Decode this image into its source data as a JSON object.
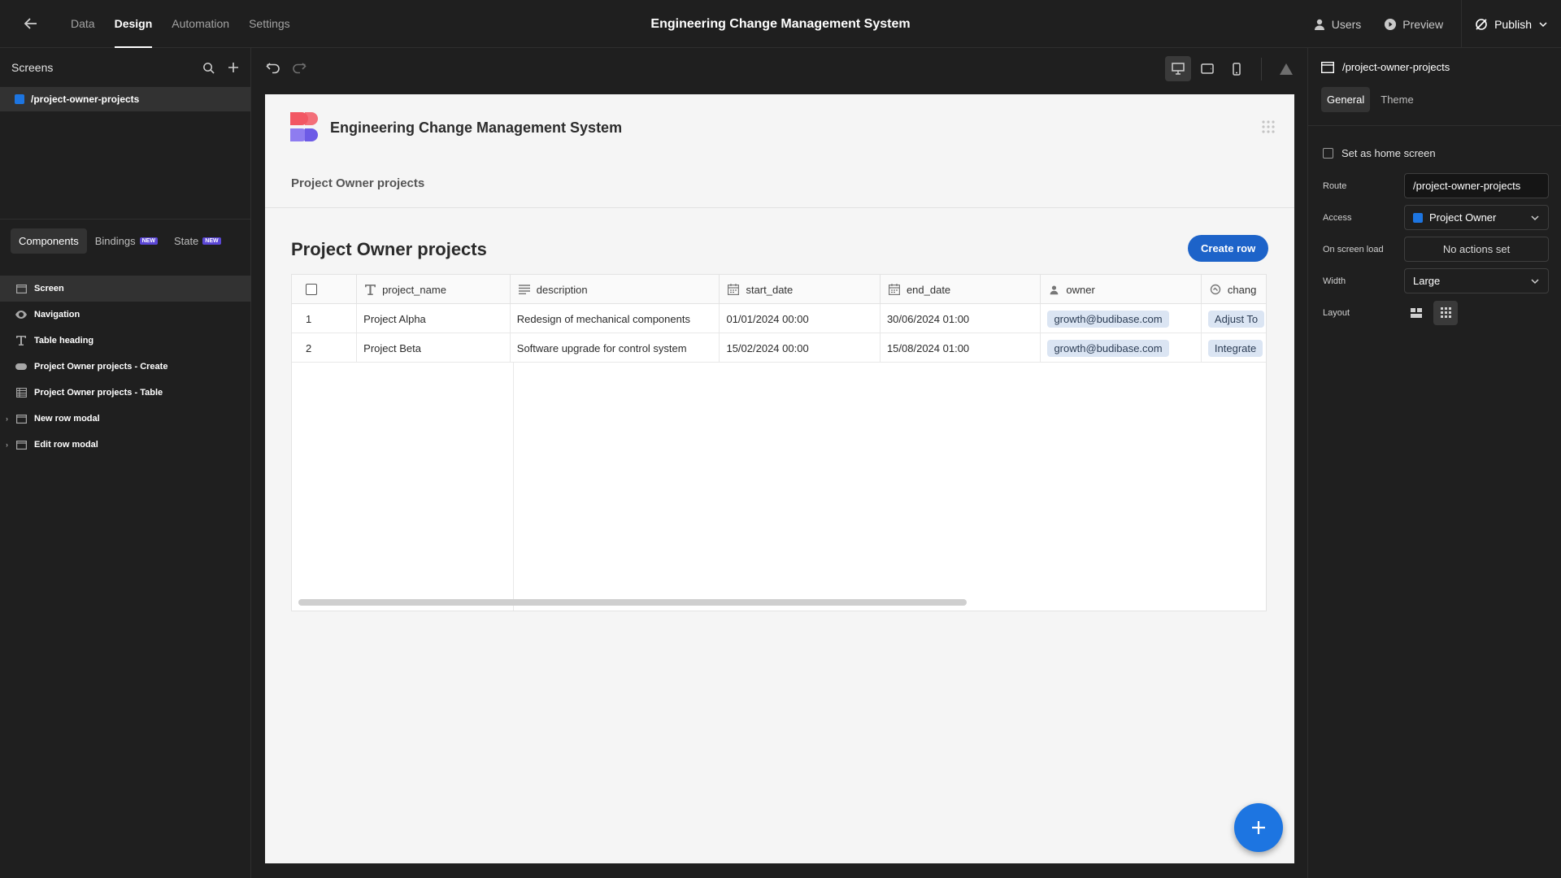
{
  "topbar": {
    "nav": [
      "Data",
      "Design",
      "Automation",
      "Settings"
    ],
    "active_nav": "Design",
    "title": "Engineering Change Management System",
    "users_label": "Users",
    "preview_label": "Preview",
    "publish_label": "Publish"
  },
  "left": {
    "screens_title": "Screens",
    "screen_route": "/project-owner-projects",
    "tabs": {
      "components": "Components",
      "bindings": "Bindings",
      "state": "State",
      "new_badge": "NEW"
    },
    "tree": [
      {
        "label": "Screen",
        "icon": "screen-icon"
      },
      {
        "label": "Navigation",
        "icon": "eye-icon"
      },
      {
        "label": "Table heading",
        "icon": "text-icon"
      },
      {
        "label": "Project Owner projects - Create",
        "icon": "button-icon"
      },
      {
        "label": "Project Owner projects - Table",
        "icon": "table-icon"
      },
      {
        "label": "New row modal",
        "icon": "modal-icon"
      },
      {
        "label": "Edit row modal",
        "icon": "modal-icon"
      }
    ]
  },
  "canvas": {
    "app_name": "Engineering Change Management System",
    "nav_link": "Project Owner projects",
    "section_title": "Project Owner projects",
    "create_button": "Create row",
    "table": {
      "columns": [
        "project_name",
        "description",
        "start_date",
        "end_date",
        "owner",
        "chang"
      ],
      "rows": [
        {
          "index": "1",
          "project_name": "Project Alpha",
          "description": "Redesign of mechanical components",
          "start_date": "01/01/2024 00:00",
          "end_date": "30/06/2024 01:00",
          "owner": "growth@budibase.com",
          "chang": "Adjust To"
        },
        {
          "index": "2",
          "project_name": "Project Beta",
          "description": "Software upgrade for control system",
          "start_date": "15/02/2024 00:00",
          "end_date": "15/08/2024 01:00",
          "owner": "growth@budibase.com",
          "chang": "Integrate"
        }
      ]
    }
  },
  "right": {
    "route_title": "/project-owner-projects",
    "tabs": [
      "General",
      "Theme"
    ],
    "home_label": "Set as home screen",
    "route_label": "Route",
    "route_value": "/project-owner-projects",
    "access_label": "Access",
    "access_value": "Project Owner",
    "onload_label": "On screen load",
    "onload_value": "No actions set",
    "width_label": "Width",
    "width_value": "Large",
    "layout_label": "Layout"
  },
  "colors": {
    "accent": "#1d75e1",
    "button": "#1d63c9",
    "badge": "#5b47d6"
  }
}
